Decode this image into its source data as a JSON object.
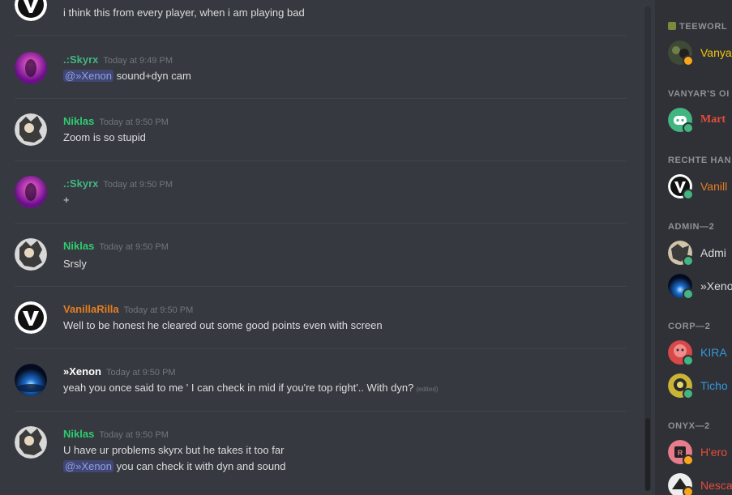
{
  "colors": {
    "green": "#43b581",
    "niklas": "#2ecc71",
    "vanilla": "#e67e22",
    "white": "#ffffff",
    "text": "#dcddde",
    "muted": "#72767d"
  },
  "messages": [
    {
      "author": "",
      "time": "",
      "lines": [
        "i think this from every player, when i am playing bad"
      ]
    },
    {
      "author": ".:Skyrx",
      "time": "Today at 9:49 PM",
      "mention": "@»Xenon",
      "lines": [
        "sound+dyn cam"
      ]
    },
    {
      "author": "Niklas",
      "time": "Today at 9:50 PM",
      "lines": [
        "Zoom is so stupid"
      ]
    },
    {
      "author": ".:Skyrx",
      "time": "Today at 9:50 PM",
      "lines": [
        "+"
      ]
    },
    {
      "author": "Niklas",
      "time": "Today at 9:50 PM",
      "lines": [
        "Srsly"
      ]
    },
    {
      "author": "VanillaRilla",
      "time": "Today at 9:50 PM",
      "lines": [
        "Well to be honest he cleared out some good points even with screen"
      ]
    },
    {
      "author": "»Xenon",
      "time": "Today at 9:50 PM",
      "lines": [
        "yeah you once said  to me ' I can check in mid if you're top right'.. With dyn?"
      ],
      "edited": "(edited)"
    },
    {
      "author": "Niklas",
      "time": "Today at 9:50 PM",
      "lines": [
        "U have ur problems skyrx but he takes it too far",
        "you can check it with dyn and sound"
      ],
      "mention": "@»Xenon"
    }
  ],
  "members": {
    "categories": [
      "TEEWORL",
      "VANYAR'S OI",
      "RECHTE HAN",
      "ADMIN—2",
      "CORP—2",
      "ONYX—2"
    ],
    "people": [
      {
        "name": "Vanya"
      },
      {
        "name": "Mart"
      },
      {
        "name": "Vanill"
      },
      {
        "name": "Admi"
      },
      {
        "name": "»Xeno"
      },
      {
        "name": "KIRA"
      },
      {
        "name": "Ticho"
      },
      {
        "name": "H'ero"
      },
      {
        "name": "Nesca"
      }
    ]
  }
}
